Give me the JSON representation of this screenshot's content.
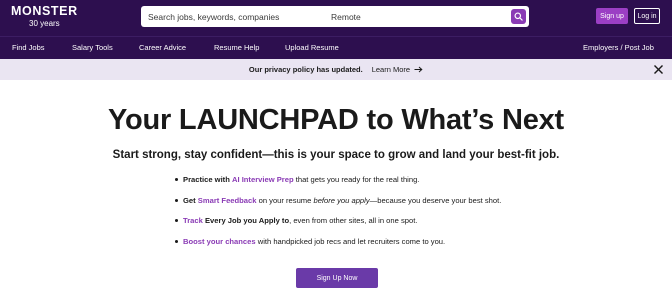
{
  "header": {
    "logo_text": "MONSTER",
    "logo_subtext": "30 years",
    "search": {
      "keywords_placeholder": "Search jobs, keywords, companies",
      "location_placeholder": "Remote"
    },
    "signup_label": "Sign up",
    "login_label": "Log in",
    "colors": {
      "bar": "#2d0f4f",
      "accent": "#9b3fc4"
    }
  },
  "nav": {
    "items": [
      "Find Jobs",
      "Salary Tools",
      "Career Advice",
      "Resume Help",
      "Upload Resume"
    ],
    "right_item": "Employers / Post Job"
  },
  "banner": {
    "text": "Our privacy policy has updated.",
    "link": "Learn More"
  },
  "hero": {
    "title": "Your LAUNCHPAD to What’s Next",
    "subtitle": "Start strong, stay confident—this is your space to grow and land your best-fit job.",
    "bullets": [
      {
        "p1": "Practice with",
        "p2": "AI Interview Prep",
        "p3": "that gets you ready for the real thing."
      },
      {
        "p1": "Get",
        "p2": "Smart Feedback",
        "p3": "on your resume",
        "p4": "before you apply",
        "p5": "—because you deserve your best shot."
      },
      {
        "p1": "Track",
        "p2": "Every Job you Apply to",
        "p3": ", even from other sites, all in one spot."
      },
      {
        "p1": "Boost your chances",
        "p2": "with handpicked job recs and let recruiters come to you."
      }
    ],
    "cta_label": "Sign Up Now"
  }
}
